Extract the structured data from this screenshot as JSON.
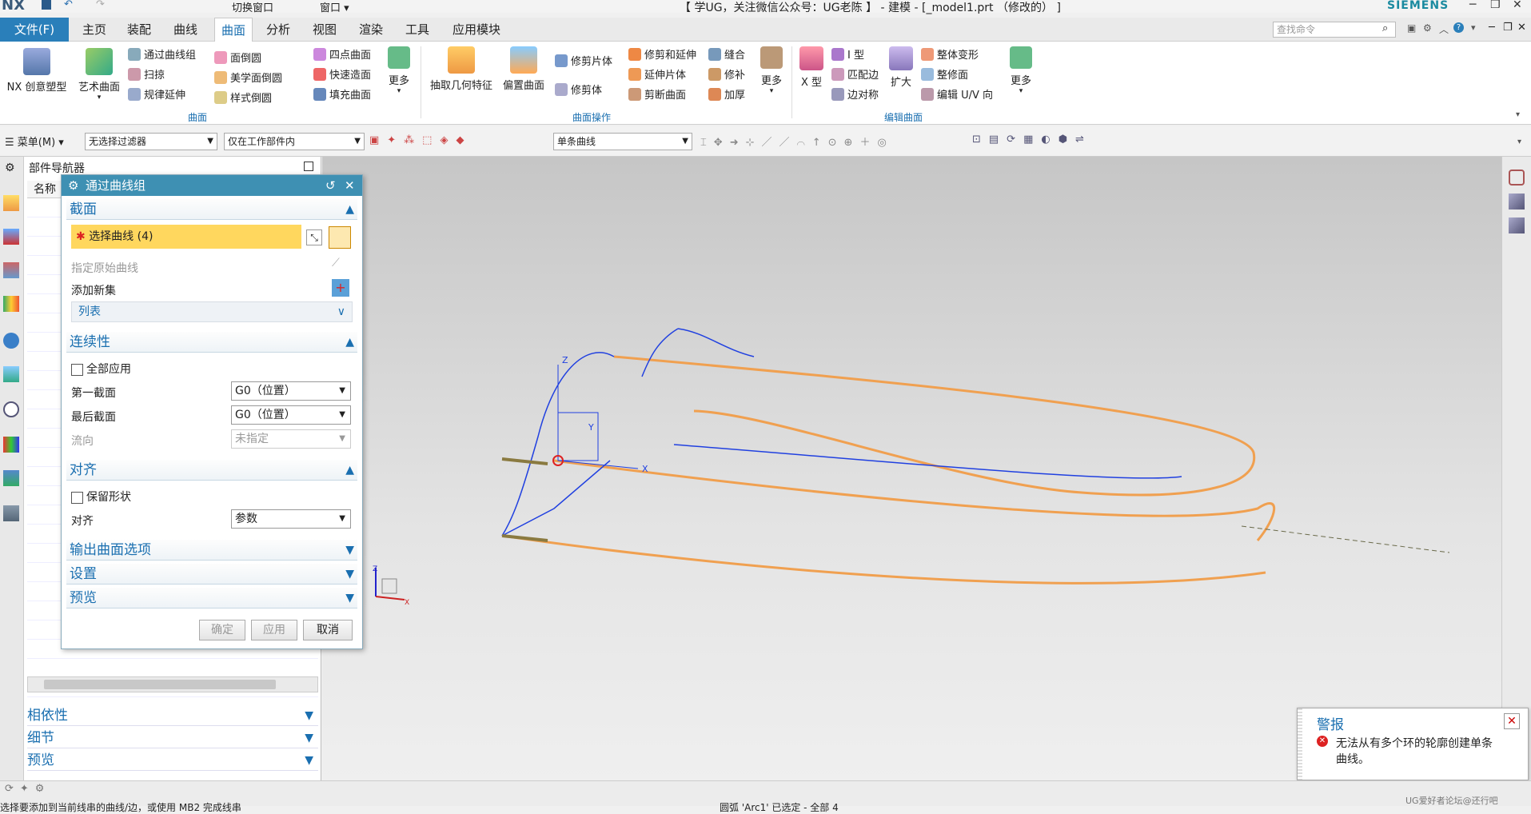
{
  "titlebar": {
    "app": "NX",
    "switch_window": "切换窗口",
    "window": "窗口",
    "title": "【 学UG，关注微信公众号：UG老陈 】 - 建模 - [_model1.prt （修改的） ]",
    "brand": "SIEMENS"
  },
  "menubar": {
    "file": "文件(F)",
    "tabs": [
      "主页",
      "装配",
      "曲线",
      "曲面",
      "分析",
      "视图",
      "渲染",
      "工具",
      "应用模块"
    ],
    "active_tab": "曲面",
    "search_placeholder": "查找命令"
  },
  "ribbon": {
    "nx_shaping": "NX 创意塑型",
    "art_surface": "艺术曲面",
    "through_curve_mesh": "通过曲线组",
    "sweep": "扫掠",
    "law_extension": "规律延伸",
    "face_blend": "面倒圆",
    "aesthetic_blend": "美学面倒圆",
    "styled_blend": "样式倒圆",
    "four_point": "四点曲面",
    "rapid_surface": "快速造面",
    "fill_surface": "填充曲面",
    "more1": "更多",
    "group_surface": "曲面",
    "extract_geometry": "抽取几何特征",
    "offset_surface": "偏置曲面",
    "trim_sheet": "修剪片体",
    "trim_body": "修剪体",
    "trim_extend": "修剪和延伸",
    "extension_sheet": "延伸片体",
    "divide_face": "剪断曲面",
    "sew": "缝合",
    "patch": "修补",
    "thicken": "加厚",
    "more2": "更多",
    "group_surface_ops": "曲面操作",
    "x_form": "X 型",
    "i_form": "I 型",
    "match_edge": "匹配边",
    "edge_symmetry": "边对称",
    "enlarge": "扩大",
    "global_shaping": "整体变形",
    "refit_face": "整修面",
    "edit_uv": "编辑 U/V 向",
    "more3": "更多",
    "group_edit_surface": "编辑曲面"
  },
  "toolbar2": {
    "menu": "菜单(M)",
    "filter": "无选择过滤器",
    "scope": "仅在工作部件内",
    "curve_rule": "单条曲线"
  },
  "navigator": {
    "title": "部件导航器",
    "col_name": "名称",
    "dependencies": "相依性",
    "details": "细节",
    "preview": "预览"
  },
  "dialog": {
    "title": "通过曲线组",
    "sections": {
      "section": "截面",
      "select_curve": "选择曲线 (4)",
      "specify_origin_curve": "指定原始曲线",
      "add_new_set": "添加新集",
      "list": "列表",
      "continuity": "连续性",
      "apply_all": "全部应用",
      "first_section": "第一截面",
      "first_section_value": "G0（位置）",
      "last_section": "最后截面",
      "last_section_value": "G0（位置）",
      "flow_direction": "流向",
      "flow_value": "未指定",
      "alignment": "对齐",
      "preserve_shape": "保留形状",
      "align_label": "对齐",
      "align_value": "参数",
      "output_surface": "输出曲面选项",
      "settings": "设置",
      "preview": "预览"
    },
    "buttons": {
      "ok": "确定",
      "apply": "应用",
      "cancel": "取消"
    }
  },
  "alert": {
    "title": "警报",
    "message": "无法从有多个环的轮廓创建单条曲线。"
  },
  "statusbar": {
    "left": "选择要添加到当前线串的曲线/边，或使用 MB2 完成线串",
    "center": "圆弧 'Arc1' 已选定 - 全部 4",
    "watermark": "UG爱好者论坛@还行吧"
  },
  "colors": {
    "accent": "#2a7fba",
    "dialog_title": "#3e90b3",
    "curve_orange": "#f0a050",
    "curve_blue": "#2040e0",
    "highlight_yellow": "#ffd75e"
  }
}
